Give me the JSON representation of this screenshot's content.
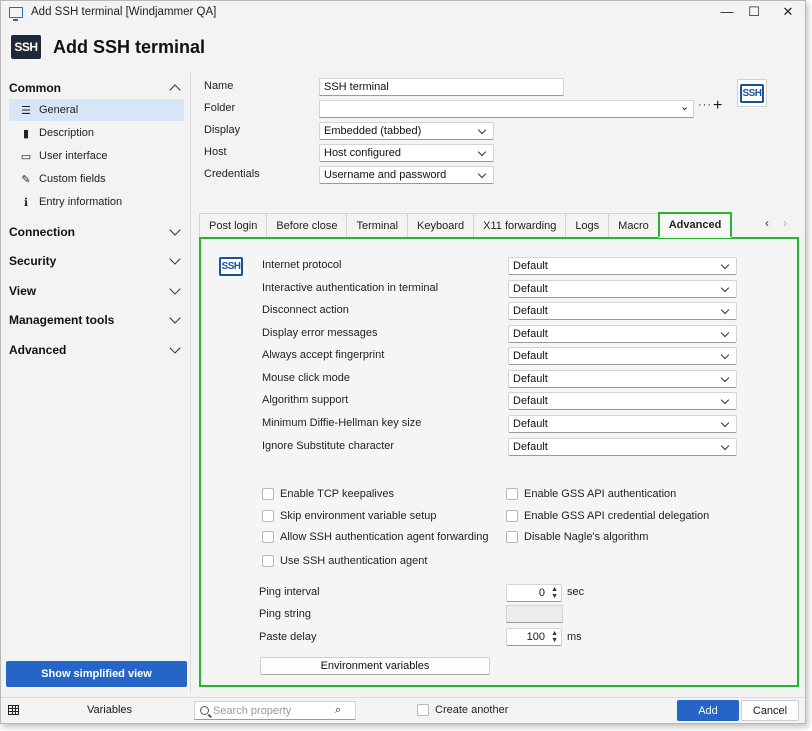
{
  "window": {
    "title": "Add SSH terminal [Windjammer QA]",
    "minimize": "—",
    "maximize": "☐",
    "close": "✕"
  },
  "header": {
    "logo_text": "SSH",
    "title": "Add SSH terminal"
  },
  "sidebar": {
    "common": {
      "label": "Common",
      "items": [
        {
          "label": "General",
          "icon": "list-icon",
          "glyph": "☰"
        },
        {
          "label": "Description",
          "icon": "clipboard-icon",
          "glyph": "▮"
        },
        {
          "label": "User interface",
          "icon": "monitor-icon",
          "glyph": "▭"
        },
        {
          "label": "Custom fields",
          "icon": "tag-edit-icon",
          "glyph": "✎"
        },
        {
          "label": "Entry information",
          "icon": "info-icon",
          "glyph": "ℹ"
        }
      ]
    },
    "sections": [
      "Connection",
      "Security",
      "View",
      "Management tools",
      "Advanced"
    ],
    "simplified_button": "Show simplified view"
  },
  "form": {
    "name": {
      "label": "Name",
      "value": "SSH terminal"
    },
    "folder": {
      "label": "Folder",
      "value": ""
    },
    "display": {
      "label": "Display",
      "value": "Embedded (tabbed)"
    },
    "host": {
      "label": "Host",
      "value": "Host configured"
    },
    "credentials": {
      "label": "Credentials",
      "value": "Username and password"
    },
    "entry_logo_text": "SSH"
  },
  "tabs": [
    "Post login",
    "Before close",
    "Terminal",
    "Keyboard",
    "X11 forwarding",
    "Logs",
    "Macro",
    "Advanced"
  ],
  "active_tab": "Advanced",
  "tab_nav": {
    "prev": "‹",
    "next": "›"
  },
  "advanced": {
    "panel_logo_text": "SSH",
    "settings": [
      {
        "label": "Internet protocol",
        "value": "Default"
      },
      {
        "label": "Interactive authentication in terminal",
        "value": "Default"
      },
      {
        "label": "Disconnect action",
        "value": "Default"
      },
      {
        "label": "Display error messages",
        "value": "Default"
      },
      {
        "label": "Always accept fingerprint",
        "value": "Default"
      },
      {
        "label": "Mouse click mode",
        "value": "Default"
      },
      {
        "label": "Algorithm support",
        "value": "Default"
      },
      {
        "label": "Minimum Diffie-Hellman key size",
        "value": "Default"
      },
      {
        "label": "Ignore Substitute character",
        "value": "Default"
      }
    ],
    "checkboxes_left": [
      {
        "label": "Enable TCP keepalives",
        "checked": false
      },
      {
        "label": "Skip environment variable setup",
        "checked": false
      },
      {
        "label": "Allow SSH authentication agent forwarding",
        "checked": false
      },
      {
        "label": "Use SSH authentication agent",
        "checked": false
      }
    ],
    "checkboxes_right": [
      {
        "label": "Enable GSS API authentication",
        "checked": false
      },
      {
        "label": "Enable GSS API credential delegation",
        "checked": false
      },
      {
        "label": "Disable Nagle's algorithm",
        "checked": false
      }
    ],
    "ping_interval": {
      "label": "Ping interval",
      "value": "0",
      "unit": "sec"
    },
    "ping_string": {
      "label": "Ping string",
      "value": ""
    },
    "paste_delay": {
      "label": "Paste delay",
      "value": "100",
      "unit": "ms"
    },
    "env_button": "Environment variables"
  },
  "bottom": {
    "variables": "Variables",
    "search_placeholder": "Search property",
    "create_another": "Create another",
    "add": "Add",
    "cancel": "Cancel"
  }
}
